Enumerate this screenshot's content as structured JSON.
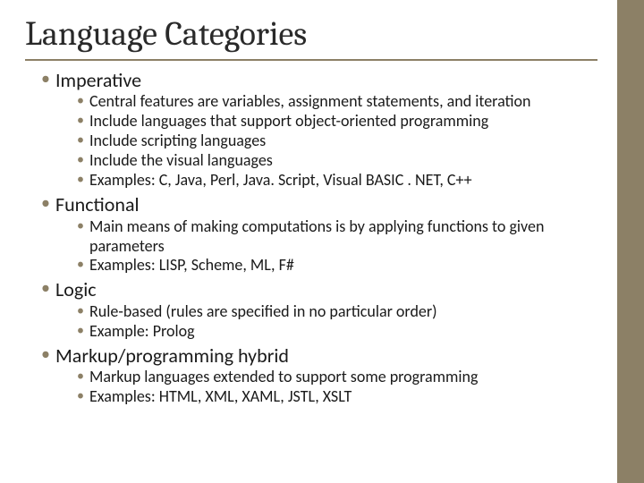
{
  "title": "Language Categories",
  "categories": [
    {
      "name": "Imperative",
      "points": [
        "Central features are variables, assignment statements, and iteration",
        "Include languages that support object-oriented programming",
        "Include scripting languages",
        "Include the visual languages",
        "Examples: C, Java, Perl, Java. Script, Visual BASIC . NET, C++"
      ]
    },
    {
      "name": "Functional",
      "points": [
        "Main means of making computations is by applying functions to given parameters",
        "Examples: LISP, Scheme, ML, F#"
      ]
    },
    {
      "name": "Logic",
      "points": [
        "Rule-based (rules are specified in no particular order)",
        "Example: Prolog"
      ]
    },
    {
      "name": "Markup/programming hybrid",
      "points": [
        "Markup languages extended to support some programming",
        "Examples: HTML, XML, XAML, JSTL, XSLT"
      ]
    }
  ]
}
